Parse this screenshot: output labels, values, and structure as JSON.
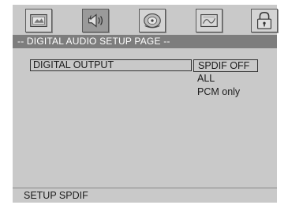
{
  "tabs": [
    {
      "icon": "general-setup-icon",
      "selected": false
    },
    {
      "icon": "audio-speaker-icon",
      "selected": true
    },
    {
      "icon": "dolby-digital-icon",
      "selected": false
    },
    {
      "icon": "video-setup-icon",
      "selected": false
    },
    {
      "icon": "lock-icon",
      "selected": false
    }
  ],
  "page_title": "-- DIGITAL AUDIO SETUP PAGE --",
  "menu": {
    "item_label": "DIGITAL OUTPUT",
    "options": [
      "SPDIF OFF",
      "ALL",
      "PCM only"
    ],
    "selected_option": "SPDIF OFF"
  },
  "status": "SETUP SPDIF"
}
